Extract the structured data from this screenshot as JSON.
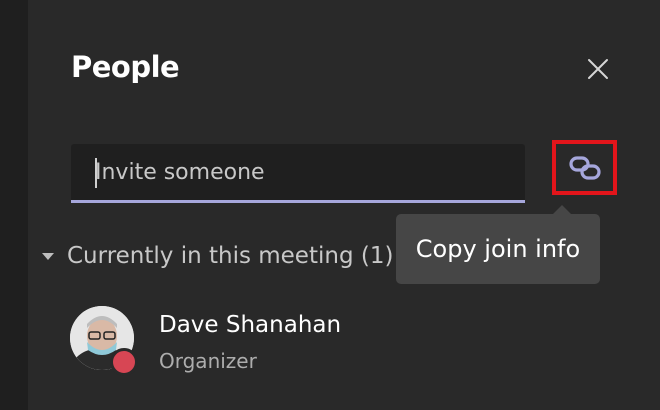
{
  "panel": {
    "title": "People",
    "close_icon": "close-icon"
  },
  "invite": {
    "placeholder": "Invite someone",
    "value": ""
  },
  "copy_link": {
    "icon": "link-icon",
    "highlight_color": "#e3151b",
    "tooltip": "Copy join info"
  },
  "section": {
    "label": "Currently in this meeting (1)",
    "expanded": true
  },
  "participants": [
    {
      "name": "Dave Shanahan",
      "role": "Organizer",
      "status_color": "#d74654"
    }
  ],
  "colors": {
    "background": "#292929",
    "accent": "#a6a7dc"
  }
}
